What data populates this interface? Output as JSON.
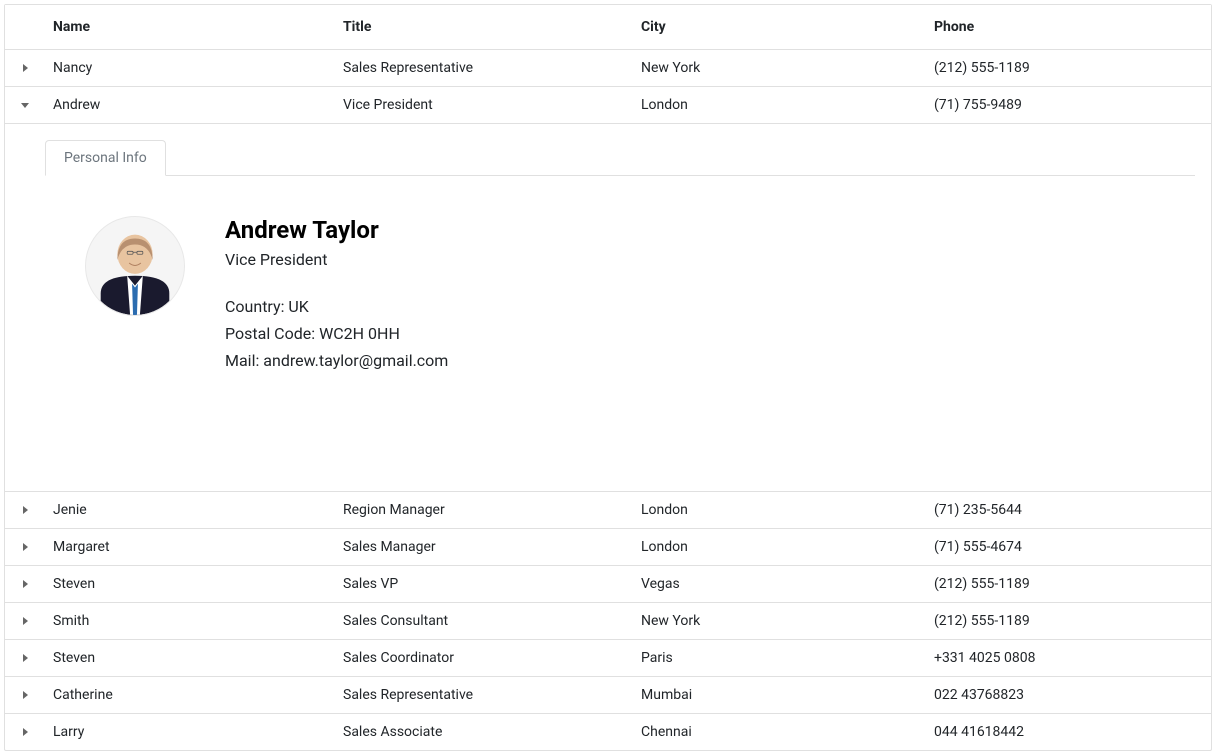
{
  "columns": {
    "name": "Name",
    "title": "Title",
    "city": "City",
    "phone": "Phone"
  },
  "rows": [
    {
      "name": "Nancy",
      "title": "Sales Representative",
      "city": "New York",
      "phone": "(212) 555-1189",
      "expanded": false
    },
    {
      "name": "Andrew",
      "title": "Vice President",
      "city": "London",
      "phone": "(71) 755-9489",
      "expanded": true
    },
    {
      "name": "Jenie",
      "title": "Region Manager",
      "city": "London",
      "phone": "(71) 235-5644",
      "expanded": false
    },
    {
      "name": "Margaret",
      "title": "Sales Manager",
      "city": "London",
      "phone": "(71) 555-4674",
      "expanded": false
    },
    {
      "name": "Steven",
      "title": "Sales VP",
      "city": "Vegas",
      "phone": "(212) 555-1189",
      "expanded": false
    },
    {
      "name": "Smith",
      "title": "Sales Consultant",
      "city": "New York",
      "phone": "(212) 555-1189",
      "expanded": false
    },
    {
      "name": "Steven",
      "title": "Sales Coordinator",
      "city": "Paris",
      "phone": "+331 4025 0808",
      "expanded": false
    },
    {
      "name": "Catherine",
      "title": "Sales Representative",
      "city": "Mumbai",
      "phone": "022 43768823",
      "expanded": false
    },
    {
      "name": "Larry",
      "title": "Sales Associate",
      "city": "Chennai",
      "phone": "044 41618442",
      "expanded": false
    }
  ],
  "detail": {
    "tabLabel": "Personal Info",
    "fullName": "Andrew Taylor",
    "title": "Vice President",
    "countryLabel": "Country: UK",
    "postalLabel": "Postal Code: WC2H 0HH",
    "mailLabel": "Mail: andrew.taylor@gmail.com"
  }
}
